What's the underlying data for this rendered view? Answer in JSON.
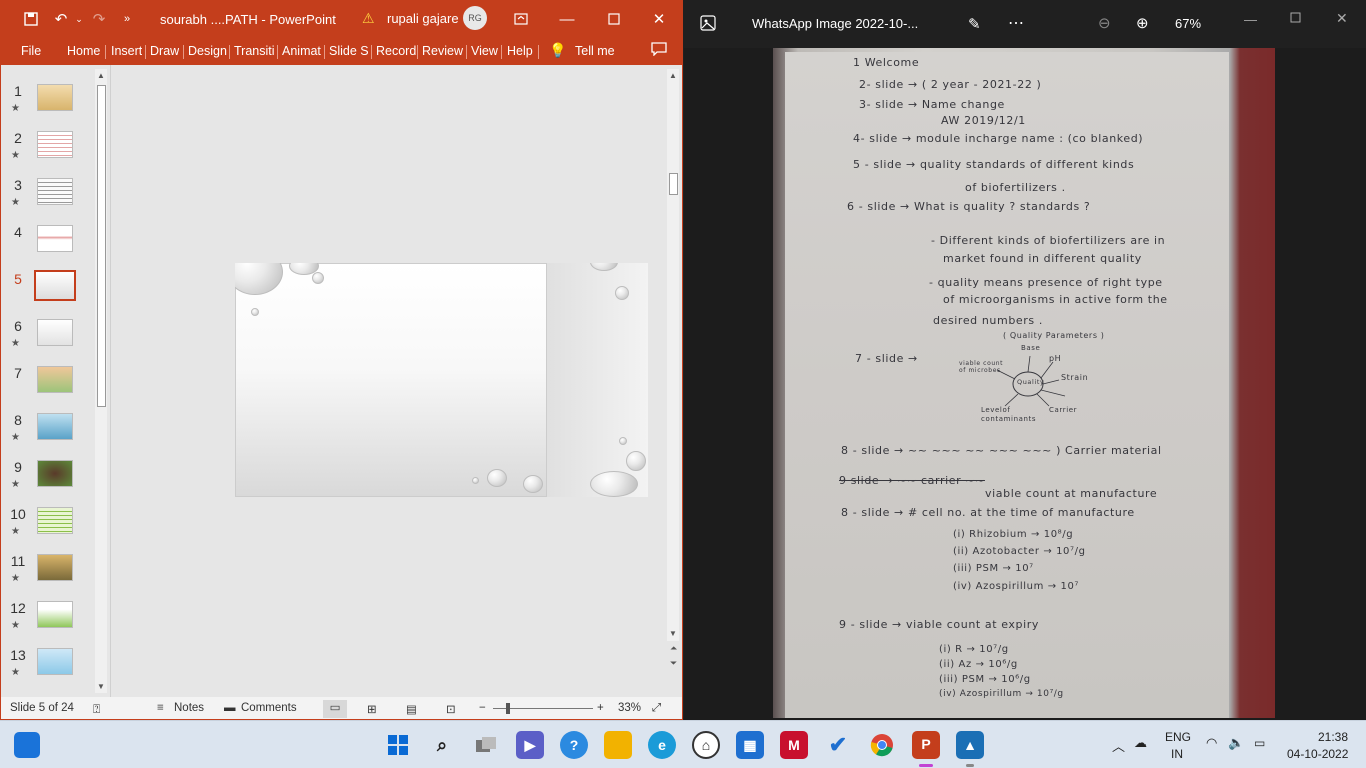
{
  "ppt": {
    "doc_title": "sourabh ....PATH  -  PowerPoint",
    "user_name": "rupali gajare",
    "user_initials": "RG",
    "tabs": [
      "File",
      "Home",
      "Insert",
      "Draw",
      "Design",
      "Transiti",
      "Animat",
      "Slide Sh",
      "Record",
      "Review",
      "View",
      "Help",
      "Tell me"
    ],
    "thumbnails": [
      {
        "num": "1",
        "star": "★"
      },
      {
        "num": "2",
        "star": "★"
      },
      {
        "num": "3",
        "star": "★"
      },
      {
        "num": "4",
        "star": ""
      },
      {
        "num": "5",
        "star": ""
      },
      {
        "num": "6",
        "star": "★"
      },
      {
        "num": "7",
        "star": ""
      },
      {
        "num": "8",
        "star": "★"
      },
      {
        "num": "9",
        "star": "★"
      },
      {
        "num": "10",
        "star": "★"
      },
      {
        "num": "11",
        "star": "★"
      },
      {
        "num": "12",
        "star": "★"
      },
      {
        "num": "13",
        "star": "★"
      }
    ],
    "selected_slide": 5,
    "status": {
      "slide_info": "Slide 5 of 24",
      "notes": "Notes",
      "comments": "Comments",
      "zoom": "33%"
    },
    "accent": "#c43e1c"
  },
  "photos": {
    "title": "WhatsApp Image 2022-10-...",
    "zoom": "67%",
    "notes_lines": [
      "1  Welcome",
      "2- slide  →  ( 2 year - 2021-22 )",
      "3- slide  →  Name change",
      "AW 2019/12/1",
      "4- slide  →  module incharge name : (co blanked)",
      "5 - slide  →  quality  standards  of  different  kinds",
      "of  biofertilizers .",
      "6 - slide  →  What  is  quality ? standards ?",
      "- Different  kinds  of  biofertilizers  are  in",
      "market  found  in  different  quality",
      "- quality  means  presence  of  right  type",
      "of  microorganisms  in  active  form  the",
      "desired  numbers .",
      "( Quality  Parameters )",
      "7 - slide  →",
      "Base",
      "viable count of microbes",
      "pH",
      "Quality",
      "Strain",
      "Levelof contaminants",
      "Carrier",
      "8 - slide  →  ~~ ~~~  ~~  ~~~  ~~~  ) Carrier material",
      "9 slide  →  ~~ carrier ~~",
      "viable  count  at  manufacture",
      "8 - slide  →  # cell  no.  at  the  time  of  manufacture",
      "(i) Rhizobium → 10⁸/g",
      "(ii) Azotobacter → 10⁷/g",
      "(iii) PSM  →  10⁷",
      "(iv) Azospirillum → 10⁷",
      "9 - slide  →  viable  count  at  expiry",
      "(i) R  →  10⁷/g",
      "(ii) Az  →  10⁶/g",
      "(iii) PSM →  10⁶/g",
      "(iv) Azospirillum → 10⁷/g"
    ]
  },
  "taskbar": {
    "lang": "ENG",
    "region": "IN",
    "time": "21:38",
    "date": "04-10-2022"
  }
}
